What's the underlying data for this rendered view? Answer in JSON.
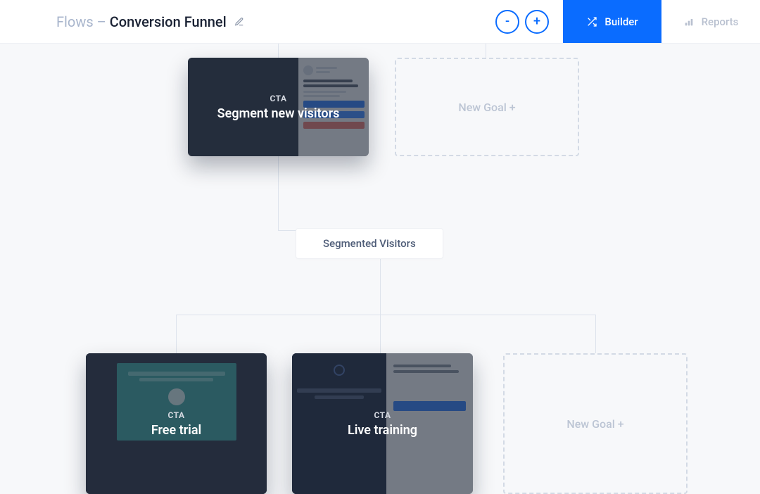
{
  "header": {
    "breadcrumb_prefix": "Flows – ",
    "breadcrumb_current": "Conversion Funnel",
    "zoom_out_label": "-",
    "zoom_in_label": "+",
    "builder_tab": "Builder",
    "reports_tab": "Reports"
  },
  "nodes": {
    "segment_new": {
      "tag": "CTA",
      "title": "Segment new visitors"
    },
    "free_trial": {
      "tag": "CTA",
      "title": "Free trial"
    },
    "live_training": {
      "tag": "CTA",
      "title": "Live training"
    }
  },
  "pill": {
    "label": "Segmented Visitors"
  },
  "placeholders": {
    "new_goal_label": "New Goal +"
  }
}
